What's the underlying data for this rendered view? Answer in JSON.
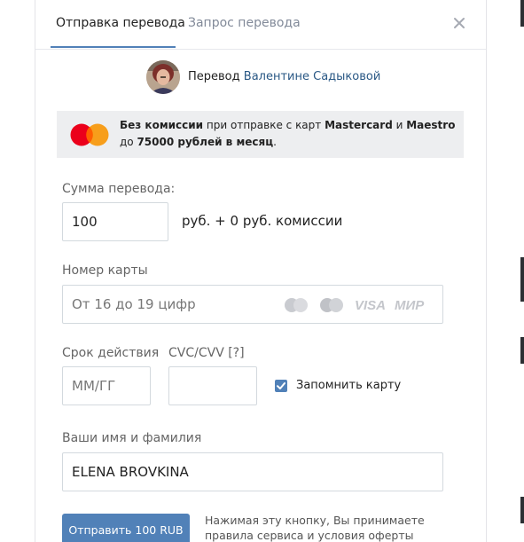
{
  "tabs": [
    {
      "label": "Отправка перевода",
      "active": true
    },
    {
      "label": "Запрос перевода",
      "active": false
    }
  ],
  "close_icon": "close-icon",
  "recipient": {
    "prefix": "Перевод",
    "name": "Валентине Садыковой"
  },
  "promo": {
    "icon": "mastercard-logo",
    "bold1": "Без комиссии",
    "text1": " при отправке с карт ",
    "bold2": "Mastercard",
    "text2": " и ",
    "bold3": "Maestro",
    "text3": " до ",
    "bold4": "75000 рублей в месяц",
    "text4": "."
  },
  "amount": {
    "label": "Сумма перевода:",
    "value": "100",
    "suffix": "руб. + 0 руб. комиссии"
  },
  "card_number": {
    "label": "Номер карты",
    "placeholder": "От 16 до 19 цифр",
    "logos": [
      "mastercard-grey",
      "maestro-grey",
      "VISA",
      "МИР"
    ]
  },
  "expiry": {
    "label": "Срок действия",
    "placeholder": "ММ/ГГ"
  },
  "cvc": {
    "label": "CVC/CVV [?]",
    "value": ""
  },
  "remember": {
    "label": "Запомнить карту",
    "checked": true
  },
  "holder": {
    "label": "Ваши имя и фамилия",
    "value": "ELENA BROVKINA"
  },
  "submit_label": "Отправить 100 RUB",
  "terms_line1": "Нажимая эту кнопку, Вы принимаете",
  "terms_line2": "правила сервиса и условия оферты",
  "colors": {
    "accent": "#5181b8",
    "link": "#2a5885",
    "promo_bg": "#edeef0"
  }
}
